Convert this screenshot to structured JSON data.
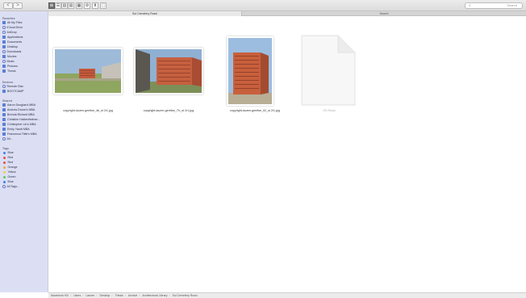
{
  "toolbar": {
    "back_label": "<",
    "forward_label": ">",
    "view_modes": [
      "⊞",
      "☰",
      "▥",
      "▤",
      "▦",
      "⚙",
      "⬆",
      "⬚"
    ],
    "search_placeholder": "Search"
  },
  "tabs": [
    {
      "label": "Sul Cemetery Rossi"
    },
    {
      "label": "Search"
    }
  ],
  "sidebar": {
    "favorites_header": "Favorites",
    "favorites": [
      {
        "label": "All My Files",
        "icon": "all-files-icon"
      },
      {
        "label": "iCloud Drive",
        "icon": "cloud-icon"
      },
      {
        "label": "AirDrop",
        "icon": "airdrop-icon"
      },
      {
        "label": "Applications",
        "icon": "applications-icon"
      },
      {
        "label": "Documents",
        "icon": "documents-icon"
      },
      {
        "label": "Desktop",
        "icon": "desktop-icon"
      },
      {
        "label": "Downloads",
        "icon": "downloads-icon"
      },
      {
        "label": "Movies",
        "icon": "movies-icon"
      },
      {
        "label": "Music",
        "icon": "music-icon"
      },
      {
        "label": "Pictures",
        "icon": "pictures-icon"
      },
      {
        "label": "Thesis",
        "icon": "folder-icon"
      }
    ],
    "devices_header": "Devices",
    "devices": [
      {
        "label": "Remote Disc",
        "icon": "disc-icon"
      },
      {
        "label": "BOOTCAMP",
        "icon": "drive-icon"
      }
    ],
    "shared_header": "Shared",
    "shared": [
      {
        "label": "Aaron Douglas's MBA",
        "icon": "computer-icon"
      },
      {
        "label": "Andrew Drone's MBA",
        "icon": "computer-icon"
      },
      {
        "label": "Brenda Richard MBA",
        "icon": "computer-icon"
      },
      {
        "label": "Christine Halberthelmer...",
        "icon": "computer-icon"
      },
      {
        "label": "Christopher Lin's MBA",
        "icon": "computer-icon"
      },
      {
        "label": "Emily Yandt MBA",
        "icon": "computer-icon"
      },
      {
        "label": "Francesca Tittle's MBA",
        "icon": "computer-icon"
      },
      {
        "label": "All...",
        "icon": "globe-icon"
      }
    ],
    "tags_header": "Tags",
    "tags": [
      {
        "label": "Blue",
        "color": "#3d7ff0"
      },
      {
        "label": "Red",
        "color": "#ee4b4b"
      },
      {
        "label": "Red",
        "color": "#ee4b4b"
      },
      {
        "label": "Orange",
        "color": "#f6a53b"
      },
      {
        "label": "Yellow",
        "color": "#f3d146"
      },
      {
        "label": "Green",
        "color": "#5bcb53"
      },
      {
        "label": "Blue",
        "color": "#3d7ff0"
      },
      {
        "label": "All Tags...",
        "color": ""
      }
    ]
  },
  "files": [
    {
      "name": "copyright-lauren-gerritse_4b_st 2r1.jpg",
      "kind": "landscape-wide"
    },
    {
      "name": "copyright-lauren-gerritse_7'b_st 2r1.jpg",
      "kind": "landscape-wall"
    },
    {
      "name": "copyright-lauren-gerritse_02_st 2r1.jpg",
      "kind": "portrait"
    },
    {
      "name": "OS Rossi",
      "kind": "document"
    }
  ],
  "pathbar": {
    "segments": [
      "Macintosh HD",
      "Users",
      "Lauren",
      "Desktop",
      "Thesis",
      "Archive",
      "Architectural Library",
      "Sul Cemetery Rossi"
    ]
  }
}
